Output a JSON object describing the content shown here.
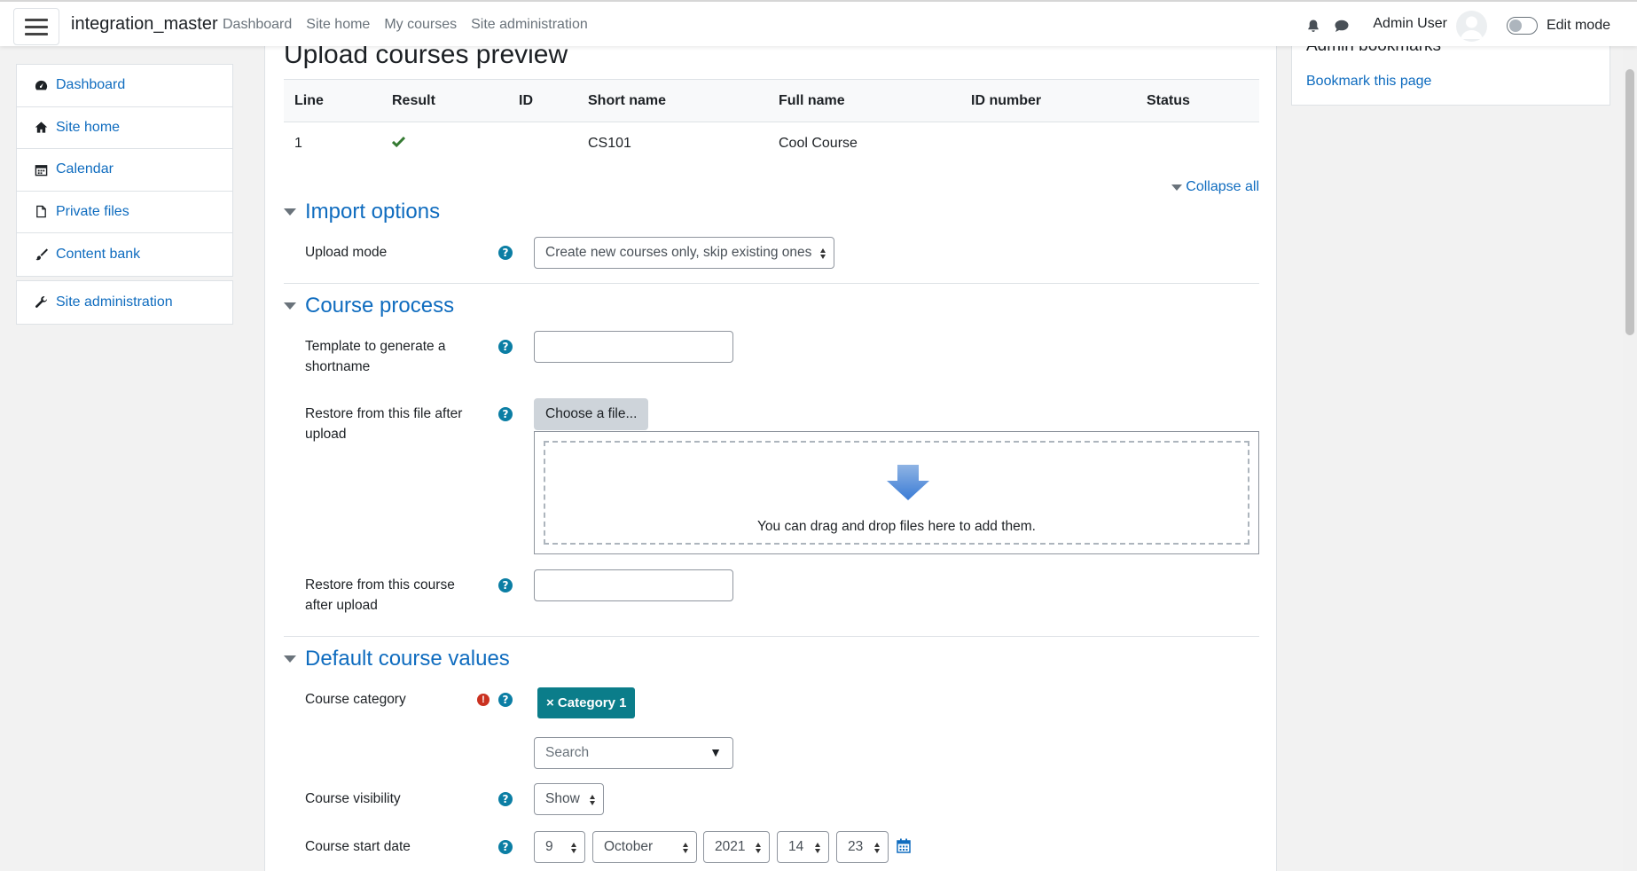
{
  "navbar": {
    "site_name": "integration_master",
    "links": [
      "Dashboard",
      "Site home",
      "My courses",
      "Site administration"
    ],
    "user_name": "Admin User",
    "edit_mode_label": "Edit mode"
  },
  "drawer": {
    "items": [
      {
        "label": "Dashboard",
        "icon": "dashboard-icon"
      },
      {
        "label": "Site home",
        "icon": "home-icon"
      },
      {
        "label": "Calendar",
        "icon": "calendar-icon"
      },
      {
        "label": "Private files",
        "icon": "file-icon"
      },
      {
        "label": "Content bank",
        "icon": "paintbrush-icon"
      }
    ],
    "admin_item": {
      "label": "Site administration",
      "icon": "wrench-icon"
    }
  },
  "page": {
    "title": "Upload courses preview",
    "table": {
      "headers": [
        "Line",
        "Result",
        "ID",
        "Short name",
        "Full name",
        "ID number",
        "Status"
      ],
      "rows": [
        {
          "line": "1",
          "result": "check-icon",
          "id": "",
          "short_name": "CS101",
          "full_name": "Cool Course",
          "id_number": "",
          "status": ""
        }
      ]
    },
    "collapse_all": "Collapse all"
  },
  "import_options": {
    "title": "Import options",
    "upload_mode_label": "Upload mode",
    "upload_mode_value": "Create new courses only, skip existing ones"
  },
  "course_process": {
    "title": "Course process",
    "template_label": "Template to generate a shortname",
    "template_value": "",
    "restore_file_label": "Restore from this file after upload",
    "choose_file": "Choose a file...",
    "dropzone_text": "You can drag and drop files here to add them.",
    "restore_course_label": "Restore from this course after upload",
    "restore_course_value": ""
  },
  "default_values": {
    "title": "Default course values",
    "category_label": "Course category",
    "category_badge": "× Category 1",
    "search_placeholder": "Search",
    "visibility_label": "Course visibility",
    "visibility_value": "Show",
    "start_date_label": "Course start date",
    "start_date": {
      "day": "9",
      "month": "October",
      "year": "2021",
      "hour": "14",
      "minute": "23"
    }
  },
  "right_block": {
    "title": "Admin bookmarks",
    "link": "Bookmark this page"
  },
  "colors": {
    "link": "#0f6cbf",
    "help": "#0b7ea4",
    "required": "#ca3120",
    "badge": "#0b7d8a",
    "success": "#357a32"
  }
}
